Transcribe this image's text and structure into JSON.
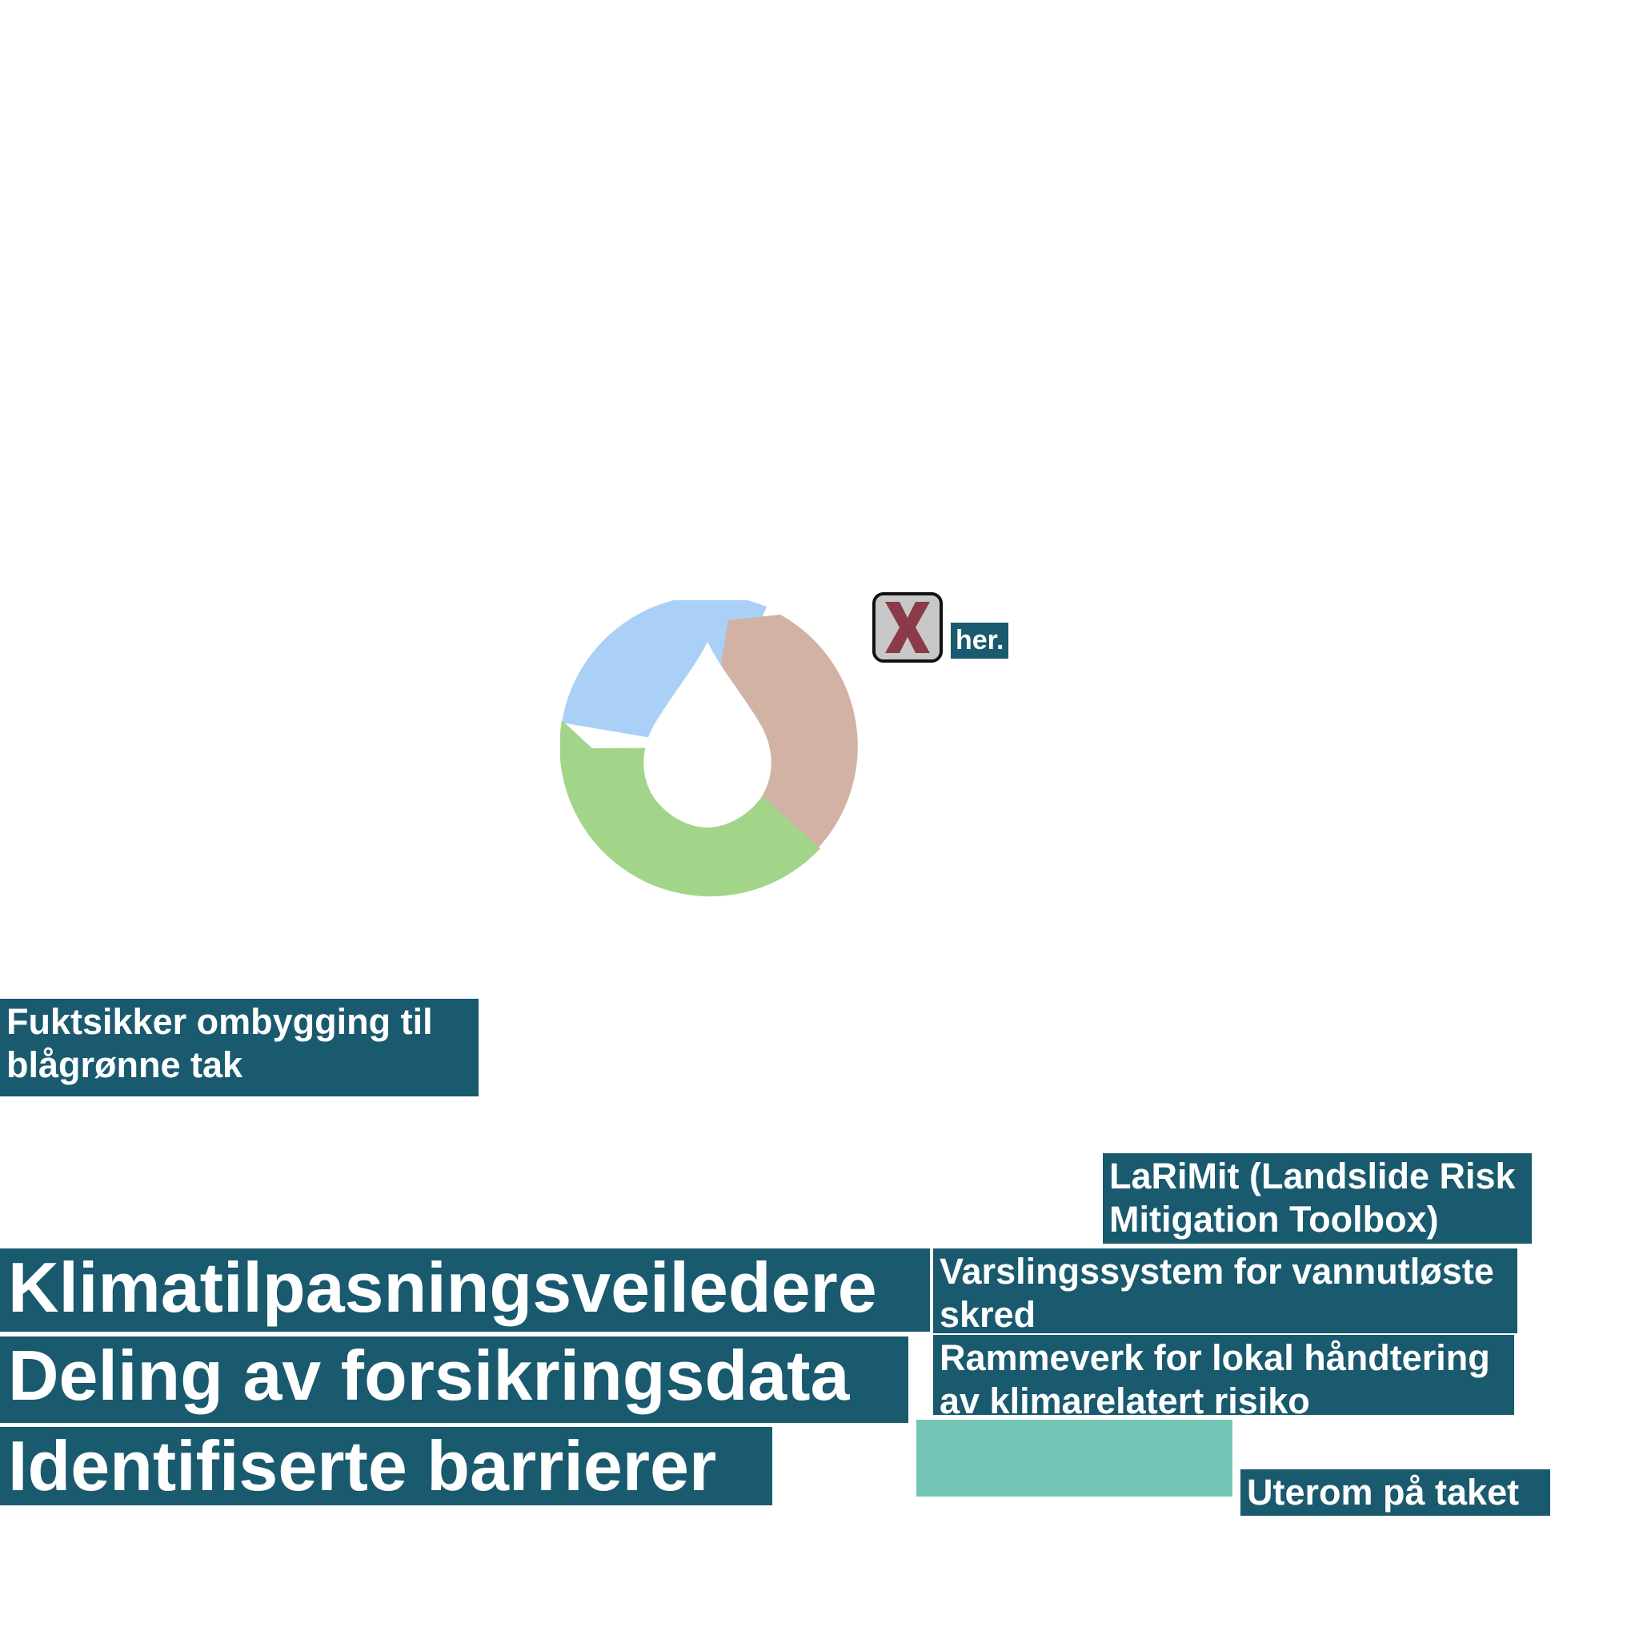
{
  "logo": {
    "icon": "water-drop-ring-icon",
    "colors": {
      "blue": "#aad0f8",
      "brown": "#d1b2a4",
      "green": "#a2d489"
    }
  },
  "close_button": {
    "icon": "close-icon",
    "color": "#8b3a4a"
  },
  "link_text": "her.",
  "tags": {
    "fuktsikker": [
      "Fuktsikker ombygging til",
      "blågrønne tak"
    ],
    "larimit": [
      "LaRiMit (Landslide Risk",
      "Mitigation Toolbox)"
    ],
    "varsling": [
      "Varslingssystem for vannutløste",
      "skred"
    ],
    "rammeverk": [
      "Rammeverk for lokal håndtering",
      "av klimarelatert risiko"
    ],
    "uterom": "Uterom på taket"
  },
  "headings": {
    "klima": "Klimatilpasningsveiledere",
    "deling": "Deling av forsikringsdata",
    "barrierer": "Identifiserte barrierer"
  },
  "colors": {
    "tag_bg": "#1a5a6e",
    "swatch": "#73c6b6"
  }
}
